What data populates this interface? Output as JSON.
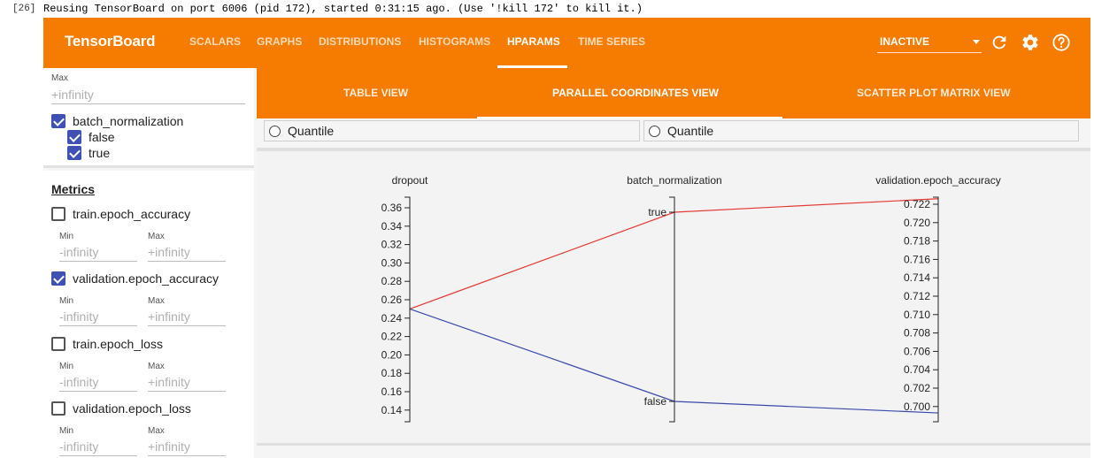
{
  "notebook": {
    "prompt": "[26]",
    "message": "Reusing TensorBoard on port 6006 (pid 172), started 0:31:15 ago. (Use '!kill 172' to kill it.)"
  },
  "topbar": {
    "brand": "TensorBoard",
    "tabs": [
      "SCALARS",
      "GRAPHS",
      "DISTRIBUTIONS",
      "HISTOGRAMS",
      "HPARAMS",
      "TIME SERIES"
    ],
    "active_tab": "HPARAMS",
    "status_select": "INACTIVE",
    "icons": [
      "refresh-icon",
      "gear-icon",
      "help-icon"
    ]
  },
  "colors": {
    "accent": "#f57c00",
    "checkbox": "#3f51b5",
    "line_true": "#e53935",
    "line_false": "#3949ab"
  },
  "sidebar": {
    "top_max_label": "Max",
    "top_max_placeholder": "+infinity",
    "batch_norm": {
      "label": "batch_normalization",
      "checked": true,
      "options": [
        {
          "label": "false",
          "checked": true
        },
        {
          "label": "true",
          "checked": true
        }
      ]
    },
    "metrics_title": "Metrics",
    "min_label": "Min",
    "max_label": "Max",
    "min_placeholder": "-infinity",
    "max_placeholder": "+infinity",
    "metrics": [
      {
        "label": "train.epoch_accuracy",
        "checked": false
      },
      {
        "label": "validation.epoch_accuracy",
        "checked": true
      },
      {
        "label": "train.epoch_loss",
        "checked": false
      },
      {
        "label": "validation.epoch_loss",
        "checked": false
      }
    ]
  },
  "subtabs": {
    "items": [
      "TABLE VIEW",
      "PARALLEL COORDINATES VIEW",
      "SCATTER PLOT MATRIX VIEW"
    ],
    "active": "PARALLEL COORDINATES VIEW"
  },
  "quantile": {
    "left_label": "Quantile",
    "right_label": "Quantile"
  },
  "parallel_coords": {
    "axes": [
      {
        "name": "dropout",
        "ticks": [
          "0.36",
          "0.34",
          "0.32",
          "0.30",
          "0.28",
          "0.26",
          "0.24",
          "0.22",
          "0.20",
          "0.18",
          "0.16",
          "0.14"
        ]
      },
      {
        "name": "batch_normalization",
        "ticks": [
          "true",
          "false"
        ]
      },
      {
        "name": "validation.epoch_accuracy",
        "ticks": [
          "0.722",
          "0.720",
          "0.718",
          "0.716",
          "0.714",
          "0.712",
          "0.710",
          "0.708",
          "0.706",
          "0.704",
          "0.702",
          "0.700"
        ]
      }
    ],
    "sessions": [
      {
        "dropout": 0.25,
        "batch_normalization": "true",
        "validation.epoch_accuracy": 0.7226
      },
      {
        "dropout": 0.25,
        "batch_normalization": "false",
        "validation.epoch_accuracy": 0.6993
      }
    ]
  }
}
